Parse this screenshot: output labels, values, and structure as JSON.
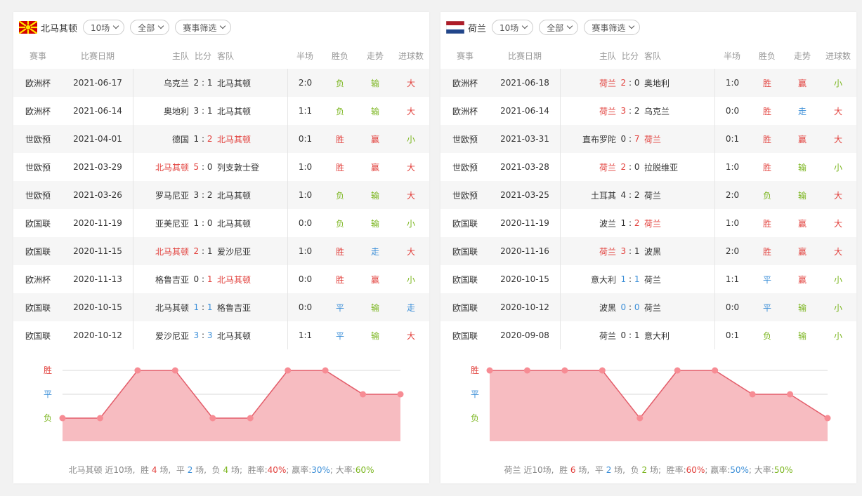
{
  "colors": {
    "win": "#e2403c",
    "draw": "#3c8fd8",
    "loss": "#7ab51d",
    "chart_fill": "#f7bcc1",
    "chart_line": "#e35d6a"
  },
  "headers": {
    "event": "赛事",
    "date": "比赛日期",
    "home": "主队",
    "score": "比分",
    "away": "客队",
    "half": "半场",
    "result": "胜负",
    "trend": "走势",
    "goals": "进球数"
  },
  "filters": {
    "count": "10场",
    "all": "全部",
    "filter": "赛事筛选"
  },
  "left": {
    "team": "北马其顿",
    "flag": "north-macedonia-flag-icon",
    "rows": [
      {
        "event": "欧洲杯",
        "date": "2021-06-17",
        "home": "乌克兰",
        "hs": "2",
        "as": "1",
        "away": "北马其顿",
        "half": "2:0",
        "result": "负",
        "trend": "输",
        "goals": "大",
        "hl": "none"
      },
      {
        "event": "欧洲杯",
        "date": "2021-06-14",
        "home": "奥地利",
        "hs": "3",
        "as": "1",
        "away": "北马其顿",
        "half": "1:1",
        "result": "负",
        "trend": "输",
        "goals": "大",
        "hl": "none"
      },
      {
        "event": "世欧预",
        "date": "2021-04-01",
        "home": "德国",
        "hs": "1",
        "as": "2",
        "away": "北马其顿",
        "half": "0:1",
        "result": "胜",
        "trend": "赢",
        "goals": "小",
        "hl": "away"
      },
      {
        "event": "世欧预",
        "date": "2021-03-29",
        "home": "北马其顿",
        "hs": "5",
        "as": "0",
        "away": "列支敦士登",
        "half": "1:0",
        "result": "胜",
        "trend": "赢",
        "goals": "大",
        "hl": "home"
      },
      {
        "event": "世欧预",
        "date": "2021-03-26",
        "home": "罗马尼亚",
        "hs": "3",
        "as": "2",
        "away": "北马其顿",
        "half": "1:0",
        "result": "负",
        "trend": "输",
        "goals": "大",
        "hl": "none"
      },
      {
        "event": "欧国联",
        "date": "2020-11-19",
        "home": "亚美尼亚",
        "hs": "1",
        "as": "0",
        "away": "北马其顿",
        "half": "0:0",
        "result": "负",
        "trend": "输",
        "goals": "小",
        "hl": "none"
      },
      {
        "event": "欧国联",
        "date": "2020-11-15",
        "home": "北马其顿",
        "hs": "2",
        "as": "1",
        "away": "爱沙尼亚",
        "half": "1:0",
        "result": "胜",
        "trend": "走",
        "goals": "大",
        "hl": "home"
      },
      {
        "event": "欧洲杯",
        "date": "2020-11-13",
        "home": "格鲁吉亚",
        "hs": "0",
        "as": "1",
        "away": "北马其顿",
        "half": "0:0",
        "result": "胜",
        "trend": "赢",
        "goals": "小",
        "hl": "away"
      },
      {
        "event": "欧国联",
        "date": "2020-10-15",
        "home": "北马其顿",
        "hs": "1",
        "as": "1",
        "away": "格鲁吉亚",
        "half": "0:0",
        "result": "平",
        "trend": "输",
        "goals": "走",
        "hl": "draw"
      },
      {
        "event": "欧国联",
        "date": "2020-10-12",
        "home": "爱沙尼亚",
        "hs": "3",
        "as": "3",
        "away": "北马其顿",
        "half": "1:1",
        "result": "平",
        "trend": "输",
        "goals": "大",
        "hl": "draw"
      }
    ],
    "summary": {
      "team": "北马其顿",
      "recent": "近10场,",
      "win_label": "胜",
      "win": "4",
      "draw_label": "平",
      "draw": "2",
      "loss_label": "负",
      "loss": "4",
      "unit": "场,",
      "unit2": "场;",
      "win_rate_label": "胜率:",
      "win_rate": "40%",
      "ying_rate_label": "赢率:",
      "ying_rate": "30%",
      "da_rate_label": "大率:",
      "da_rate": "60%"
    }
  },
  "right": {
    "team": "荷兰",
    "flag": "netherlands-flag-icon",
    "rows": [
      {
        "event": "欧洲杯",
        "date": "2021-06-18",
        "home": "荷兰",
        "hs": "2",
        "as": "0",
        "away": "奥地利",
        "half": "1:0",
        "result": "胜",
        "trend": "赢",
        "goals": "小",
        "hl": "home"
      },
      {
        "event": "欧洲杯",
        "date": "2021-06-14",
        "home": "荷兰",
        "hs": "3",
        "as": "2",
        "away": "乌克兰",
        "half": "0:0",
        "result": "胜",
        "trend": "走",
        "goals": "大",
        "hl": "home"
      },
      {
        "event": "世欧预",
        "date": "2021-03-31",
        "home": "直布罗陀",
        "hs": "0",
        "as": "7",
        "away": "荷兰",
        "half": "0:1",
        "result": "胜",
        "trend": "赢",
        "goals": "大",
        "hl": "away"
      },
      {
        "event": "世欧预",
        "date": "2021-03-28",
        "home": "荷兰",
        "hs": "2",
        "as": "0",
        "away": "拉脱维亚",
        "half": "1:0",
        "result": "胜",
        "trend": "输",
        "goals": "小",
        "hl": "home"
      },
      {
        "event": "世欧预",
        "date": "2021-03-25",
        "home": "土耳其",
        "hs": "4",
        "as": "2",
        "away": "荷兰",
        "half": "2:0",
        "result": "负",
        "trend": "输",
        "goals": "大",
        "hl": "none"
      },
      {
        "event": "欧国联",
        "date": "2020-11-19",
        "home": "波兰",
        "hs": "1",
        "as": "2",
        "away": "荷兰",
        "half": "1:0",
        "result": "胜",
        "trend": "赢",
        "goals": "大",
        "hl": "away"
      },
      {
        "event": "欧国联",
        "date": "2020-11-16",
        "home": "荷兰",
        "hs": "3",
        "as": "1",
        "away": "波黑",
        "half": "2:0",
        "result": "胜",
        "trend": "赢",
        "goals": "大",
        "hl": "home"
      },
      {
        "event": "欧国联",
        "date": "2020-10-15",
        "home": "意大利",
        "hs": "1",
        "as": "1",
        "away": "荷兰",
        "half": "1:1",
        "result": "平",
        "trend": "赢",
        "goals": "小",
        "hl": "draw"
      },
      {
        "event": "欧国联",
        "date": "2020-10-12",
        "home": "波黑",
        "hs": "0",
        "as": "0",
        "away": "荷兰",
        "half": "0:0",
        "result": "平",
        "trend": "输",
        "goals": "小",
        "hl": "draw"
      },
      {
        "event": "欧国联",
        "date": "2020-09-08",
        "home": "荷兰",
        "hs": "0",
        "as": "1",
        "away": "意大利",
        "half": "0:1",
        "result": "负",
        "trend": "输",
        "goals": "小",
        "hl": "none"
      }
    ],
    "summary": {
      "team": "荷兰",
      "recent": "近10场,",
      "win_label": "胜",
      "win": "6",
      "draw_label": "平",
      "draw": "2",
      "loss_label": "负",
      "loss": "2",
      "unit": "场,",
      "unit2": "场;",
      "win_rate_label": "胜率:",
      "win_rate": "60%",
      "ying_rate_label": "赢率:",
      "ying_rate": "50%",
      "da_rate_label": "大率:",
      "da_rate": "50%"
    }
  },
  "chart_data": [
    {
      "type": "area",
      "y_categories": [
        "负",
        "平",
        "胜"
      ],
      "values": [
        0,
        0,
        2,
        2,
        0,
        0,
        2,
        2,
        1,
        1
      ],
      "grid": true
    },
    {
      "type": "area",
      "y_categories": [
        "负",
        "平",
        "胜"
      ],
      "values": [
        2,
        2,
        2,
        2,
        0,
        2,
        2,
        1,
        1,
        0
      ],
      "grid": true
    }
  ]
}
